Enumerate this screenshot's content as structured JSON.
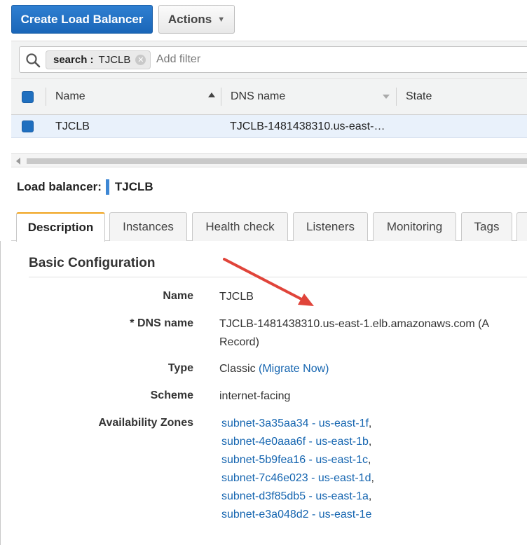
{
  "toolbar": {
    "create_label": "Create Load Balancer",
    "actions_label": "Actions"
  },
  "filter": {
    "chip_key": "search :",
    "chip_value": "TJCLB",
    "placeholder": "Add filter"
  },
  "table": {
    "columns": [
      "Name",
      "DNS name",
      "State"
    ],
    "rows": [
      {
        "name": "TJCLB",
        "dns": "TJCLB-1481438310.us-east-…",
        "state": ""
      }
    ]
  },
  "detail": {
    "heading_label": "Load balancer:",
    "heading_value": "TJCLB"
  },
  "tabs": [
    "Description",
    "Instances",
    "Health check",
    "Listeners",
    "Monitoring",
    "Tags"
  ],
  "config": {
    "title": "Basic Configuration",
    "name_label": "Name",
    "name_value": "TJCLB",
    "dns_label": "* DNS name",
    "dns_value_line1": "TJCLB-1481438310.us-east-1.elb.amazonaws.com (A",
    "dns_value_line2": "Record)",
    "type_label": "Type",
    "type_value": "Classic",
    "migrate_link": "(Migrate Now)",
    "scheme_label": "Scheme",
    "scheme_value": "internet-facing",
    "az_label": "Availability Zones",
    "subnets": [
      "subnet-3a35aa34 - us-east-1f",
      "subnet-4e0aaa6f - us-east-1b",
      "subnet-5b9fea16 - us-east-1c",
      "subnet-7c46e023 - us-east-1d",
      "subnet-d3f85db5 - us-east-1a",
      "subnet-e3a048d2 - us-east-1e"
    ]
  },
  "colors": {
    "primary": "#1f6fbf",
    "link": "#1565b0",
    "active_tab_accent": "#f0a31c",
    "annotation_arrow": "#e0443a"
  }
}
